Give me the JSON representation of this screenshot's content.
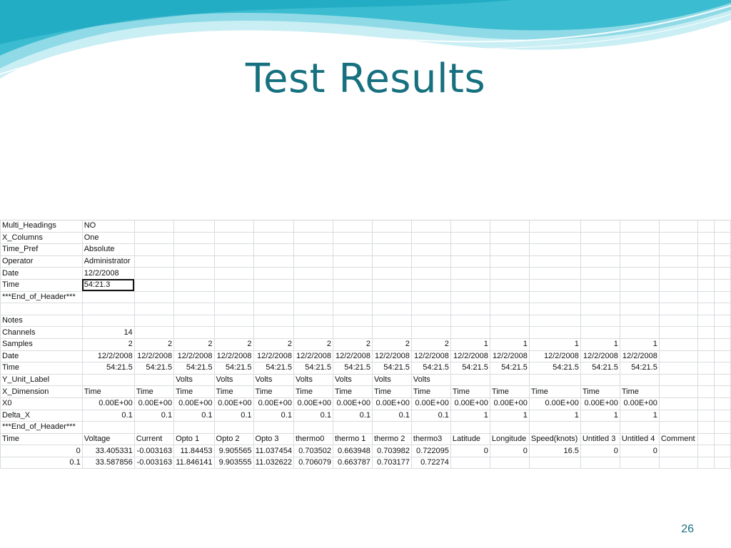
{
  "slide": {
    "title": "Test Results",
    "page_number": "26"
  },
  "colors": {
    "title": "#17707f",
    "wave_dark": "#3bbcd0",
    "wave_light": "#c9eef4",
    "grid_line": "#d8dcdf"
  },
  "spreadsheet": {
    "rows": [
      [
        "Multi_Headings",
        "NO",
        "",
        "",
        "",
        "",
        "",
        "",
        "",
        "",
        "",
        "",
        "",
        "",
        "",
        "",
        "",
        ""
      ],
      [
        "X_Columns",
        "One",
        "",
        "",
        "",
        "",
        "",
        "",
        "",
        "",
        "",
        "",
        "",
        "",
        "",
        "",
        "",
        ""
      ],
      [
        "Time_Pref",
        "Absolute",
        "",
        "",
        "",
        "",
        "",
        "",
        "",
        "",
        "",
        "",
        "",
        "",
        "",
        "",
        "",
        ""
      ],
      [
        "Operator",
        "Administrator",
        "",
        "",
        "",
        "",
        "",
        "",
        "",
        "",
        "",
        "",
        "",
        "",
        "",
        "",
        "",
        ""
      ],
      [
        "Date",
        "12/2/2008",
        "",
        "",
        "",
        "",
        "",
        "",
        "",
        "",
        "",
        "",
        "",
        "",
        "",
        "",
        "",
        ""
      ],
      [
        "Time",
        "54:21.3",
        "",
        "",
        "",
        "",
        "",
        "",
        "",
        "",
        "",
        "",
        "",
        "",
        "",
        "",
        "",
        ""
      ],
      [
        "***End_of_Header***",
        "",
        "",
        "",
        "",
        "",
        "",
        "",
        "",
        "",
        "",
        "",
        "",
        "",
        "",
        "",
        "",
        ""
      ],
      [
        "",
        "",
        "",
        "",
        "",
        "",
        "",
        "",
        "",
        "",
        "",
        "",
        "",
        "",
        "",
        "",
        "",
        ""
      ],
      [
        "Notes",
        "",
        "",
        "",
        "",
        "",
        "",
        "",
        "",
        "",
        "",
        "",
        "",
        "",
        "",
        "",
        "",
        ""
      ],
      [
        "Channels",
        "14",
        "",
        "",
        "",
        "",
        "",
        "",
        "",
        "",
        "",
        "",
        "",
        "",
        "",
        "",
        "",
        ""
      ],
      [
        "Samples",
        "2",
        "2",
        "2",
        "2",
        "2",
        "2",
        "2",
        "2",
        "2",
        "1",
        "1",
        "1",
        "1",
        "1",
        "",
        "",
        ""
      ],
      [
        "Date",
        "12/2/2008",
        "12/2/2008",
        "12/2/2008",
        "12/2/2008",
        "12/2/2008",
        "12/2/2008",
        "12/2/2008",
        "12/2/2008",
        "12/2/2008",
        "12/2/2008",
        "12/2/2008",
        "12/2/2008",
        "12/2/2008",
        "12/2/2008",
        "",
        "",
        ""
      ],
      [
        "Time",
        "54:21.5",
        "54:21.5",
        "54:21.5",
        "54:21.5",
        "54:21.5",
        "54:21.5",
        "54:21.5",
        "54:21.5",
        "54:21.5",
        "54:21.5",
        "54:21.5",
        "54:21.5",
        "54:21.5",
        "54:21.5",
        "",
        "",
        ""
      ],
      [
        "Y_Unit_Label",
        "",
        "",
        "Volts",
        "Volts",
        "Volts",
        "Volts",
        "Volts",
        "Volts",
        "Volts",
        "",
        "",
        "",
        "",
        "",
        "",
        "",
        ""
      ],
      [
        "X_Dimension",
        "Time",
        "Time",
        "Time",
        "Time",
        "Time",
        "Time",
        "Time",
        "Time",
        "Time",
        "Time",
        "Time",
        "Time",
        "Time",
        "Time",
        "",
        "",
        ""
      ],
      [
        "X0",
        "0.00E+00",
        "0.00E+00",
        "0.00E+00",
        "0.00E+00",
        "0.00E+00",
        "0.00E+00",
        "0.00E+00",
        "0.00E+00",
        "0.00E+00",
        "0.00E+00",
        "0.00E+00",
        "0.00E+00",
        "0.00E+00",
        "0.00E+00",
        "",
        "",
        ""
      ],
      [
        "Delta_X",
        "0.1",
        "0.1",
        "0.1",
        "0.1",
        "0.1",
        "0.1",
        "0.1",
        "0.1",
        "0.1",
        "1",
        "1",
        "1",
        "1",
        "1",
        "",
        "",
        ""
      ],
      [
        "***End_of_Header***",
        "",
        "",
        "",
        "",
        "",
        "",
        "",
        "",
        "",
        "",
        "",
        "",
        "",
        "",
        "",
        "",
        ""
      ],
      [
        "Time",
        "Voltage",
        "Current",
        "Opto 1",
        "Opto 2",
        "Opto 3",
        "thermo0",
        "thermo 1",
        "thermo 2",
        "thermo3",
        "Latitude",
        "Longitude",
        "Speed(knots)",
        "Untitled 3",
        "Untitled 4",
        "Comment",
        "",
        ""
      ],
      [
        "0",
        "33.405331",
        "-0.003163",
        "11.84453",
        "9.905565",
        "11.037454",
        "0.703502",
        "0.663948",
        "0.703982",
        "0.722095",
        "0",
        "0",
        "16.5",
        "0",
        "0",
        "",
        "",
        ""
      ],
      [
        "0.1",
        "33.587856",
        "-0.003163",
        "11.846141",
        "9.903555",
        "11.032622",
        "0.706079",
        "0.663787",
        "0.703177",
        "0.72274",
        "",
        "",
        "",
        "",
        "",
        "",
        "",
        ""
      ]
    ],
    "selected_cell": "F2"
  }
}
